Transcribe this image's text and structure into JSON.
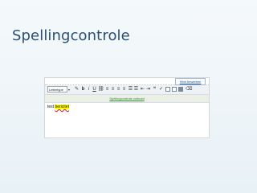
{
  "slide": {
    "title": "Spellingcontrole"
  },
  "editor": {
    "edit_link": "Html bewerken",
    "toolbar": {
      "font_select_value": "Lettertype",
      "bold": "b",
      "italic": "i",
      "underline": "U"
    },
    "spell_status": "Spellingcontrole voltooid",
    "content": {
      "word_ok": "test",
      "word_misspelled": "bericitet"
    }
  },
  "colors": {
    "title": "#2a4f73",
    "spell_status": "#2e8b2e",
    "highlight": "#ffff00"
  }
}
